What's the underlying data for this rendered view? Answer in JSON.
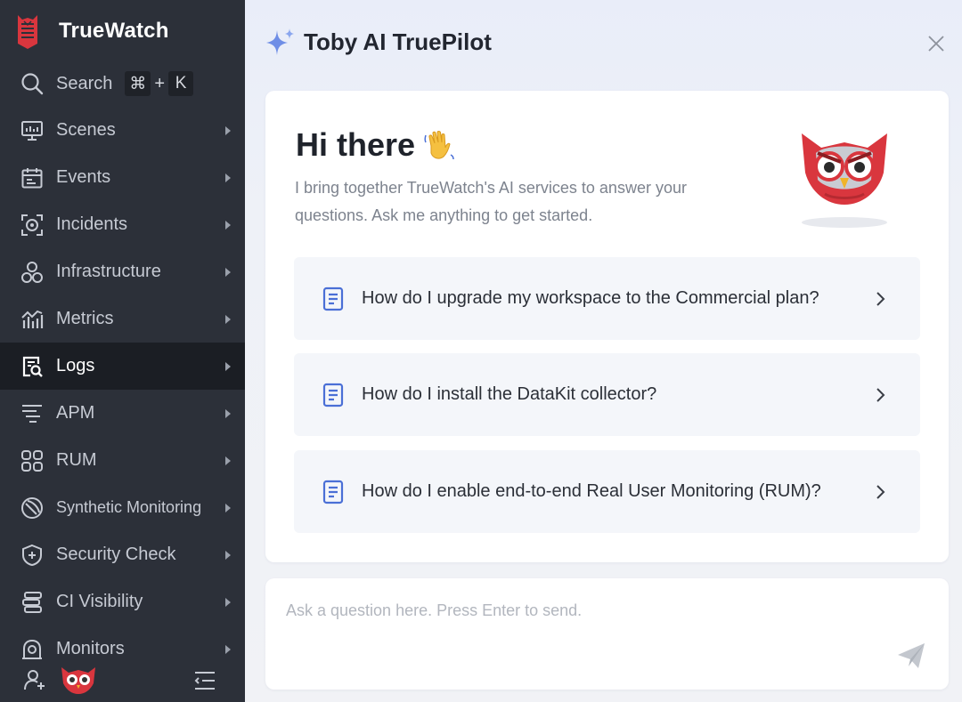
{
  "app": {
    "name": "TrueWatch"
  },
  "search": {
    "label": "Search",
    "shortcut_mod": "⌘",
    "shortcut_plus": "+",
    "shortcut_key": "K"
  },
  "nav": [
    {
      "label": "Scenes",
      "icon": "monitor-icon",
      "active": false
    },
    {
      "label": "Events",
      "icon": "calendar-icon",
      "active": false
    },
    {
      "label": "Incidents",
      "icon": "incident-icon",
      "active": false
    },
    {
      "label": "Infrastructure",
      "icon": "nodes-icon",
      "active": false
    },
    {
      "label": "Metrics",
      "icon": "metrics-icon",
      "active": false
    },
    {
      "label": "Logs",
      "icon": "log-search-icon",
      "active": true
    },
    {
      "label": "APM",
      "icon": "apm-icon",
      "active": false
    },
    {
      "label": "RUM",
      "icon": "rum-icon",
      "active": false
    },
    {
      "label": "Synthetic Monitoring",
      "icon": "synthetic-icon",
      "active": false
    },
    {
      "label": "Security Check",
      "icon": "shield-icon",
      "active": false
    },
    {
      "label": "CI Visibility",
      "icon": "ci-icon",
      "active": false
    },
    {
      "label": "Monitors",
      "icon": "monitor-alarm-icon",
      "active": false
    }
  ],
  "assistant": {
    "title": "Toby AI TruePilot",
    "greeting": "Hi there",
    "intro": "I bring together TrueWatch's AI services to answer your questions. Ask me anything to get started.",
    "suggestions": [
      "How do I upgrade my workspace to the Commercial plan?",
      "How do I install the DataKit collector?",
      "How do I enable end-to-end Real User Monitoring (RUM)?"
    ],
    "input_placeholder": "Ask a question here. Press Enter to send."
  },
  "colors": {
    "sidebar": "#2c3039",
    "sidebar_active": "#1b1e24",
    "accent": "#4a6fd6",
    "brand_red": "#d9363e"
  }
}
